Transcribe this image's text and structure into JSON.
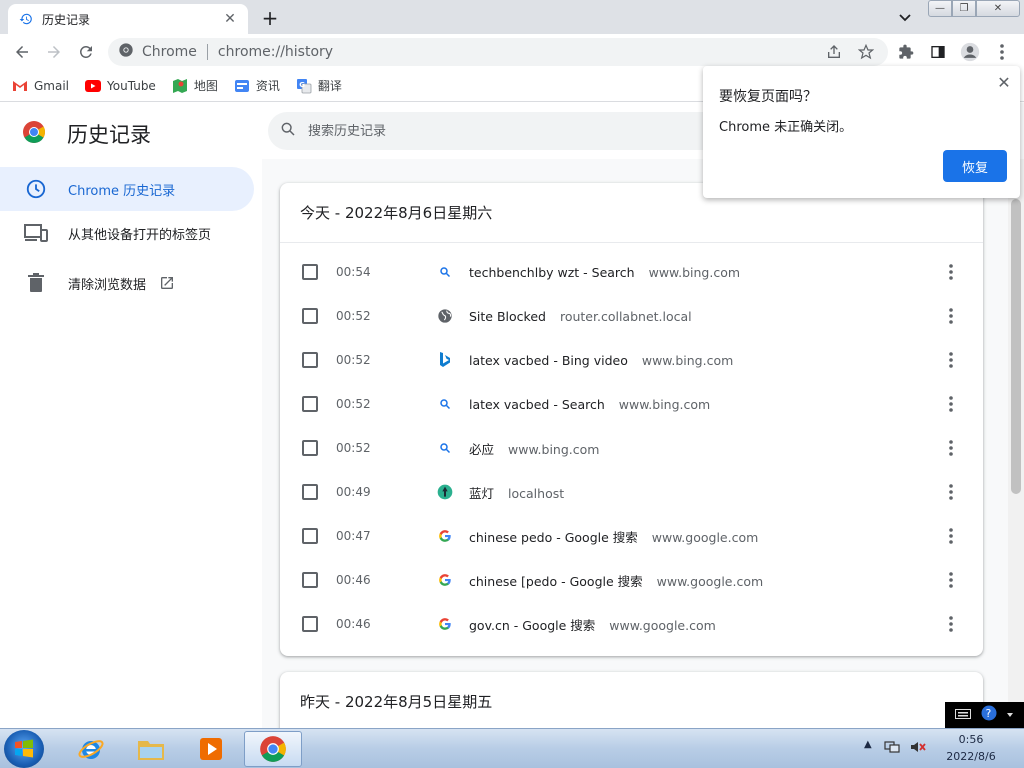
{
  "tab": {
    "title": "历史记录"
  },
  "toolbar": {
    "site_chip": "Chrome",
    "url": "chrome://history"
  },
  "bookmarks": [
    {
      "label": "Gmail"
    },
    {
      "label": "YouTube"
    },
    {
      "label": "地图"
    },
    {
      "label": "资讯"
    },
    {
      "label": "翻译"
    }
  ],
  "page": {
    "title": "历史记录",
    "search_placeholder": "搜索历史记录"
  },
  "sidebar": {
    "items": [
      {
        "label": "Chrome 历史记录"
      },
      {
        "label": "从其他设备打开的标签页"
      },
      {
        "label": "清除浏览数据"
      }
    ]
  },
  "today": {
    "title": "今天 - 2022年8月6日星期六",
    "entries": [
      {
        "time": "00:54",
        "title": "techbenchlby wzt - Search",
        "domain": "www.bing.com",
        "icon": "search-icon"
      },
      {
        "time": "00:52",
        "title": "Site Blocked",
        "domain": "router.collabnet.local",
        "icon": "globe-icon"
      },
      {
        "time": "00:52",
        "title": "latex vacbed - Bing video",
        "domain": "www.bing.com",
        "icon": "bing-icon"
      },
      {
        "time": "00:52",
        "title": "latex vacbed - Search",
        "domain": "www.bing.com",
        "icon": "search-icon"
      },
      {
        "time": "00:52",
        "title": "必应",
        "domain": "www.bing.com",
        "icon": "search-icon"
      },
      {
        "time": "00:49",
        "title": "蓝灯",
        "domain": "localhost",
        "icon": "lantern-icon"
      },
      {
        "time": "00:47",
        "title": "chinese pedo - Google 搜索",
        "domain": "www.google.com",
        "icon": "google-icon"
      },
      {
        "time": "00:46",
        "title": "chinese [pedo - Google 搜索",
        "domain": "www.google.com",
        "icon": "google-icon"
      },
      {
        "time": "00:46",
        "title": "gov.cn - Google 搜索",
        "domain": "www.google.com",
        "icon": "google-icon"
      }
    ]
  },
  "yesterday": {
    "title": "昨天 - 2022年8月5日星期五"
  },
  "restore": {
    "title": "要恢复页面吗？",
    "message": "Chrome 未正确关闭。",
    "button": "恢复"
  },
  "taskbar": {
    "time": "0:56",
    "date": "2022/8/6"
  },
  "colors": {
    "accent": "#1a73e8",
    "active_bg": "#e8f0fe",
    "active_text": "#1967d2"
  }
}
